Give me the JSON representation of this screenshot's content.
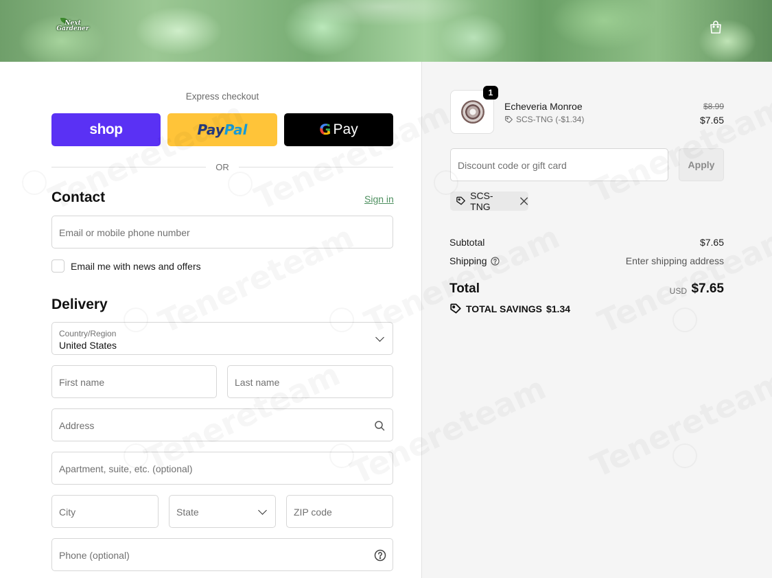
{
  "header": {
    "logo_text_line1": "Next",
    "logo_text_line2": "Gardener",
    "cart_icon": "shopping-bag-icon"
  },
  "express": {
    "label": "Express checkout",
    "shop_label": "shop",
    "paypal_part1": "Pay",
    "paypal_part2": "Pal",
    "gpay_g": "G",
    "gpay_label": "Pay",
    "or_label": "OR"
  },
  "contact": {
    "title": "Contact",
    "signin_label": "Sign in",
    "email_placeholder": "Email me with news and offers",
    "email_field_placeholder": "Email or mobile phone number",
    "newsletter_label": "Email me with news and offers"
  },
  "delivery": {
    "title": "Delivery",
    "country_label": "Country/Region",
    "country_value": "United States",
    "first_name": "First name",
    "last_name": "Last name",
    "address": "Address",
    "apartment": "Apartment, suite, etc. (optional)",
    "city": "City",
    "state": "State",
    "zip": "ZIP code",
    "phone": "Phone (optional)"
  },
  "order": {
    "quantity": "1",
    "product_name": "Echeveria Monroe",
    "discount_line": "SCS-TNG (-$1.34)",
    "original_price": "$8.99",
    "price": "$7.65",
    "discount_placeholder": "Discount code or gift card",
    "apply_label": "Apply",
    "applied_code": "SCS-TNG",
    "subtotal_label": "Subtotal",
    "subtotal_value": "$7.65",
    "shipping_label": "Shipping",
    "shipping_value": "Enter shipping address",
    "total_label": "Total",
    "currency": "USD",
    "total_value": "$7.65",
    "savings_label": "TOTAL SAVINGS",
    "savings_value": "$1.34"
  },
  "colors": {
    "shop_purple": "#5a31f4",
    "paypal_yellow": "#ffc439",
    "link_green": "#4c8f5e"
  },
  "watermark": {
    "text_1": "Tenereteam",
    "text_2": "Tenereteam",
    "text_3": "Tenereteam",
    "text_4": "Tenereteam",
    "text_5": "Tenereteam",
    "text_6": "Tenereteam",
    "text_7": "Tenereteam",
    "text_8": "Tenereteam",
    "text_9": "Tenereteam"
  }
}
